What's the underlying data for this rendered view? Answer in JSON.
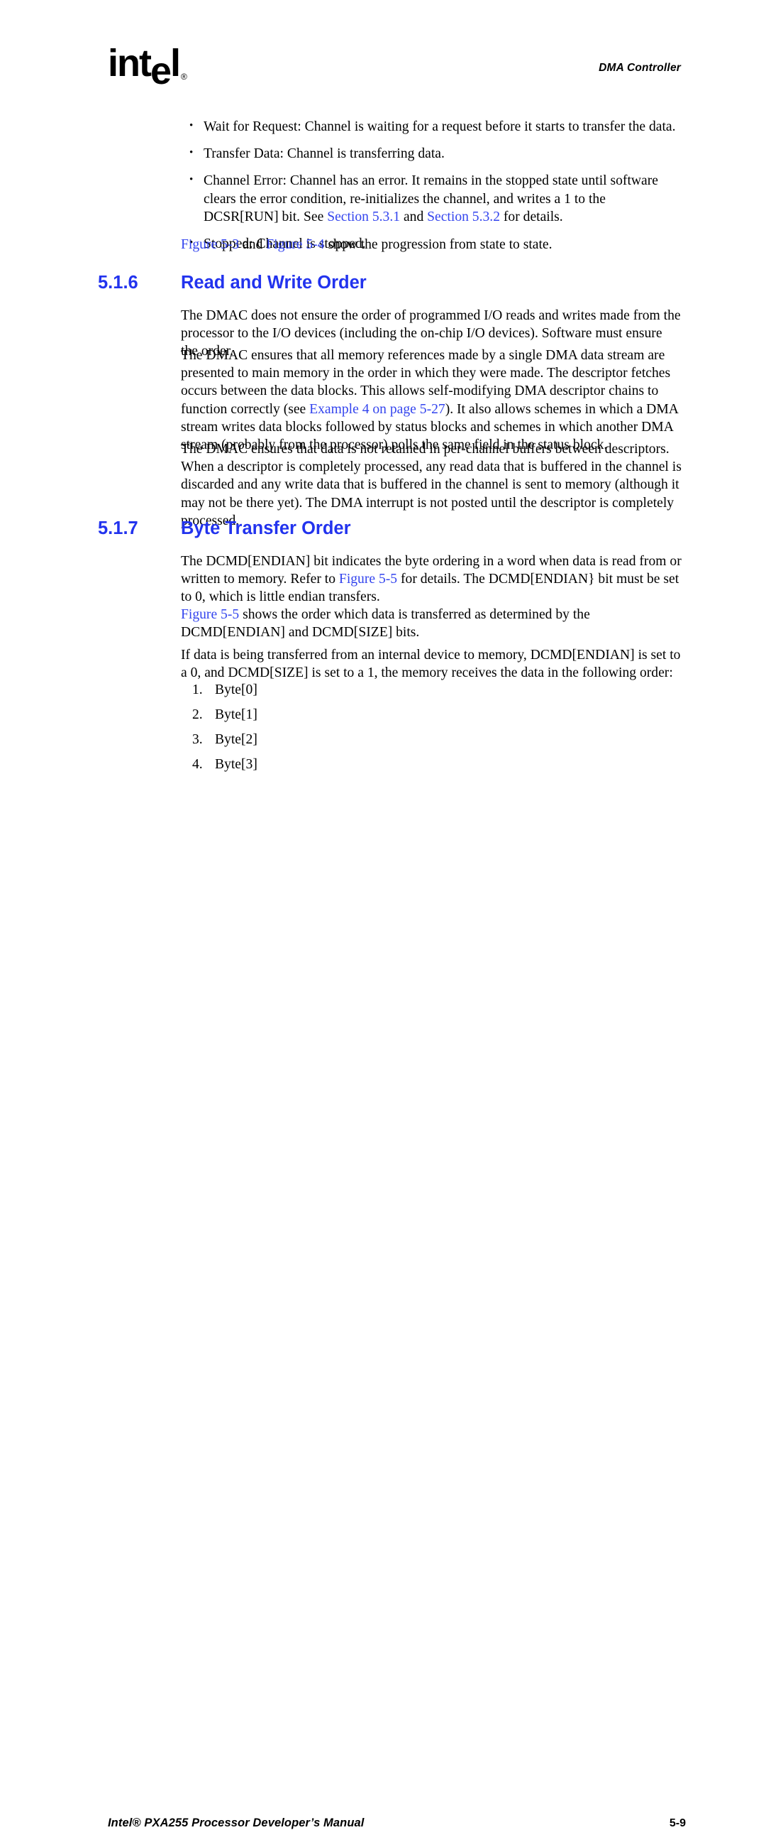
{
  "header": {
    "logo_text_1": "int",
    "logo_text_e": "e",
    "logo_text_2": "l",
    "logo_registered": "®",
    "chapter_title": "DMA Controller"
  },
  "bullets": [
    {
      "id": "wait-for-request",
      "parts": [
        {
          "text": "Wait for Request: Channel is waiting for a request before it starts to transfer the data.",
          "link": false
        }
      ]
    },
    {
      "id": "transfer-data",
      "parts": [
        {
          "text": "Transfer Data: Channel is transferring data.",
          "link": false
        }
      ]
    },
    {
      "id": "channel-error",
      "parts": [
        {
          "text": "Channel Error: Channel has an error. It remains in the stopped state until software clears the error condition, re-initializes the channel, and writes a 1 to the DCSR[RUN] bit. See ",
          "link": false
        },
        {
          "text": "Section 5.3.1",
          "link": true
        },
        {
          "text": " and ",
          "link": false
        },
        {
          "text": "Section 5.3.2",
          "link": true
        },
        {
          "text": " for details.",
          "link": false
        }
      ]
    },
    {
      "id": "stopped",
      "parts": [
        {
          "text": "Stopped: Channel is stopped.",
          "link": false
        }
      ]
    }
  ],
  "figure_note": {
    "parts": [
      {
        "text": "Figure 5-3",
        "link": true
      },
      {
        "text": " and ",
        "link": false
      },
      {
        "text": "Figure 5-4",
        "link": true
      },
      {
        "text": " show the progression from state to state.",
        "link": false
      }
    ]
  },
  "section_516": {
    "number": "5.1.6",
    "title": "Read and Write Order",
    "paragraphs": [
      {
        "id": "dmac-order-io",
        "parts": [
          {
            "text": "The DMAC does not ensure the order of programmed I/O reads and writes made from the processor to the I/O devices (including the on-chip I/O devices). Software must ensure the order.",
            "link": false
          }
        ]
      },
      {
        "id": "dmac-memory-refs",
        "parts": [
          {
            "text": "The DMAC ensures that all memory references made by a single DMA data stream are presented to main memory in the order in which they were made. The descriptor fetches occurs between the data blocks. This allows self-modifying DMA descriptor chains to function correctly (see ",
            "link": false
          },
          {
            "text": "Example 4 on page 5-27",
            "link": true
          },
          {
            "text": "). It also allows schemes in which a DMA stream writes data blocks followed by status blocks and schemes in which another DMA stream (probably from the processor) polls the same field in the status block.",
            "link": false
          }
        ]
      },
      {
        "id": "dmac-per-channel-buffers",
        "parts": [
          {
            "text": "The DMAC ensures that data is not retained in per-channel buffers between descriptors. When a descriptor is completely processed, any read data that is buffered in the channel is discarded and any write data that is buffered in the channel is sent to memory (although it may not be there yet). The DMA interrupt is not posted until the descriptor is completely processed.",
            "link": false
          }
        ]
      }
    ]
  },
  "section_517": {
    "number": "5.1.7",
    "title": "Byte Transfer Order",
    "paragraphs": [
      {
        "id": "dcmd-endian-bit",
        "parts": [
          {
            "text": "The DCMD[ENDIAN] bit indicates the byte ordering in a word when data is read from or written to memory. Refer to ",
            "link": false
          },
          {
            "text": "Figure 5-5",
            "link": true
          },
          {
            "text": " for details. The DCMD[ENDIAN} bit must be set to 0, which is little endian transfers.",
            "link": false
          }
        ]
      },
      {
        "id": "figure55-order",
        "parts": [
          {
            "text": "Figure 5-5",
            "link": true
          },
          {
            "text": " shows the order which data is transferred as determined by the DCMD[ENDIAN] and DCMD[SIZE] bits.",
            "link": false
          }
        ]
      },
      {
        "id": "internal-device-to-memory",
        "parts": [
          {
            "text": "If data is being transferred from an internal device to memory, DCMD[ENDIAN] is set to a 0, and DCMD[SIZE] is set to a 1, the memory receives the data in the following order:",
            "link": false
          }
        ]
      }
    ],
    "byte_order_list": [
      {
        "num": "1.",
        "label": "Byte[0]"
      },
      {
        "num": "2.",
        "label": "Byte[1]"
      },
      {
        "num": "3.",
        "label": "Byte[2]"
      },
      {
        "num": "4.",
        "label": "Byte[3]"
      }
    ]
  },
  "footer": {
    "manual_title": "Intel® PXA255 Processor Developer’s Manual",
    "page_number": "5-9"
  },
  "colors": {
    "link_blue": "#3344ee",
    "heading_blue": "#2233ee",
    "text_black": "#000000",
    "page_background": "#ffffff"
  }
}
